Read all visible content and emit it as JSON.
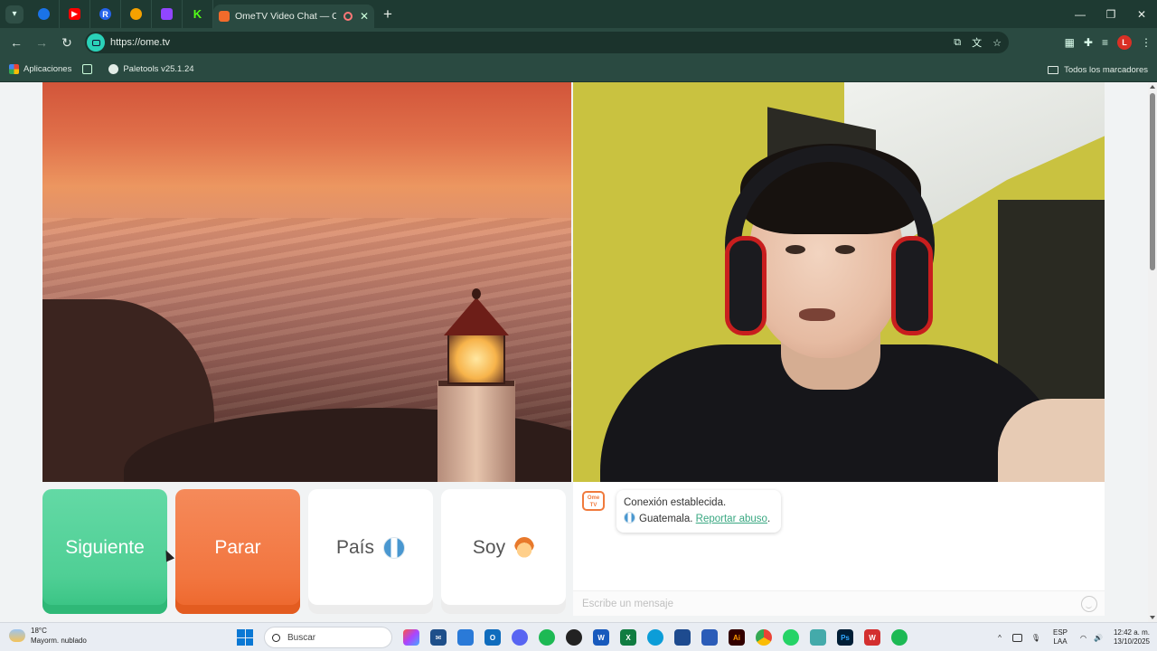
{
  "browser": {
    "tab_title": "OmeTV Video Chat — Omegle",
    "url": "https://ome.tv",
    "profile_initial": "L",
    "new_tab_symbol": "+",
    "bookmarks": {
      "apps_label": "Aplicaciones",
      "paletools_label": "Paletools v25.1.24",
      "all_bookmarks_label": "Todos los marcadores"
    }
  },
  "video_chat": {
    "buttons": {
      "next_label": "Siguiente",
      "stop_label": "Parar",
      "country_label": "País",
      "gender_label": "Soy"
    },
    "chat": {
      "logo_text": "Ome TV",
      "status_line": "Conexión establecida.",
      "country": "Guatemala.",
      "report_link": "Reportar abuso",
      "report_suffix": ".",
      "input_placeholder": "Escribe un mensaje"
    },
    "colors": {
      "next": "#4fcf95",
      "stop": "#f27640",
      "link": "#3aa882"
    }
  },
  "taskbar": {
    "weather_temp": "18°C",
    "weather_desc": "Mayorm. nublado",
    "search_label": "Buscar",
    "lang_1": "ESP",
    "lang_2": "LAA",
    "time": "12:42 a. m.",
    "date": "13/10/2025"
  }
}
